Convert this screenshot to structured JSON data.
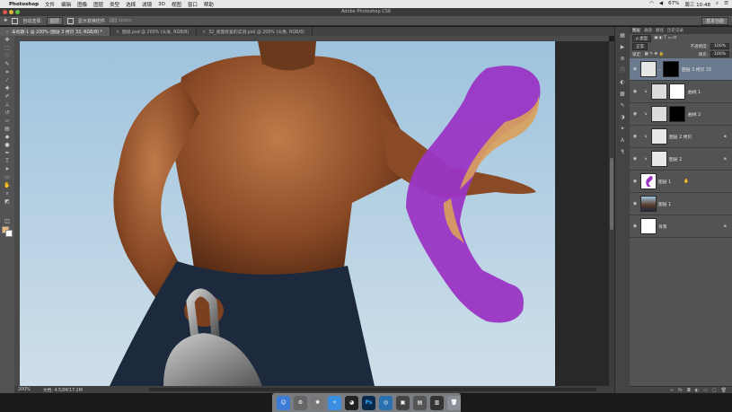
{
  "menubar": {
    "app": "Photoshop",
    "items": [
      "文件",
      "编辑",
      "图像",
      "图层",
      "类型",
      "选择",
      "滤镜",
      "3D",
      "视图",
      "窗口",
      "帮助"
    ],
    "battery": "67%",
    "time": "周三 10:48"
  },
  "titlebar": {
    "title": "Adobe Photoshop CS6"
  },
  "options": {
    "auto_select_label": "自动选择:",
    "auto_select_value": "图层",
    "transform_label": "显示变换控件",
    "workspace": "基本功能"
  },
  "tabs": [
    {
      "label": "未标题-1 @ 200% (图层 3 拷贝 33, RGB/8) *",
      "active": true
    },
    {
      "label": "图纸.psd @ 200% (头发, RGB/8)",
      "active": false
    },
    {
      "label": "32_底图修复的实测.psd @ 200% (头像, RGB/8)",
      "active": false
    }
  ],
  "status": {
    "zoom": "200%",
    "doc": "文档: 4.52M/17.2M"
  },
  "panel": {
    "tabs": [
      "图层",
      "通道",
      "路径",
      "历史记录"
    ],
    "blend_mode": "正常",
    "opacity_label": "不透明度:",
    "opacity": "100%",
    "lock_label": "锁定:",
    "fill_label": "填充:",
    "fill": "100%",
    "layers": [
      {
        "name": "图层 3 拷贝 33",
        "thumb": "white",
        "mask": true,
        "selected": true,
        "lock": false
      },
      {
        "name": "曲线 1",
        "thumb": "white",
        "mask": true,
        "selected": false,
        "lock": false
      },
      {
        "name": "曲线 2",
        "thumb": "white",
        "mask": true,
        "selected": false,
        "lock": false
      },
      {
        "name": "图层 2 拷贝",
        "thumb": "white",
        "mask": false,
        "selected": false,
        "lock": true
      },
      {
        "name": "图层 2",
        "thumb": "white",
        "mask": false,
        "selected": false,
        "lock": true
      },
      {
        "name": "图层 1",
        "thumb": "purple",
        "mask": false,
        "selected": false,
        "lock": false
      },
      {
        "name": "图层 1",
        "thumb": "photo",
        "mask": false,
        "selected": false,
        "lock": false
      },
      {
        "name": "背景",
        "thumb": "white",
        "mask": false,
        "selected": false,
        "lock": true
      }
    ]
  },
  "dock": {
    "ps_label": "Ps"
  }
}
